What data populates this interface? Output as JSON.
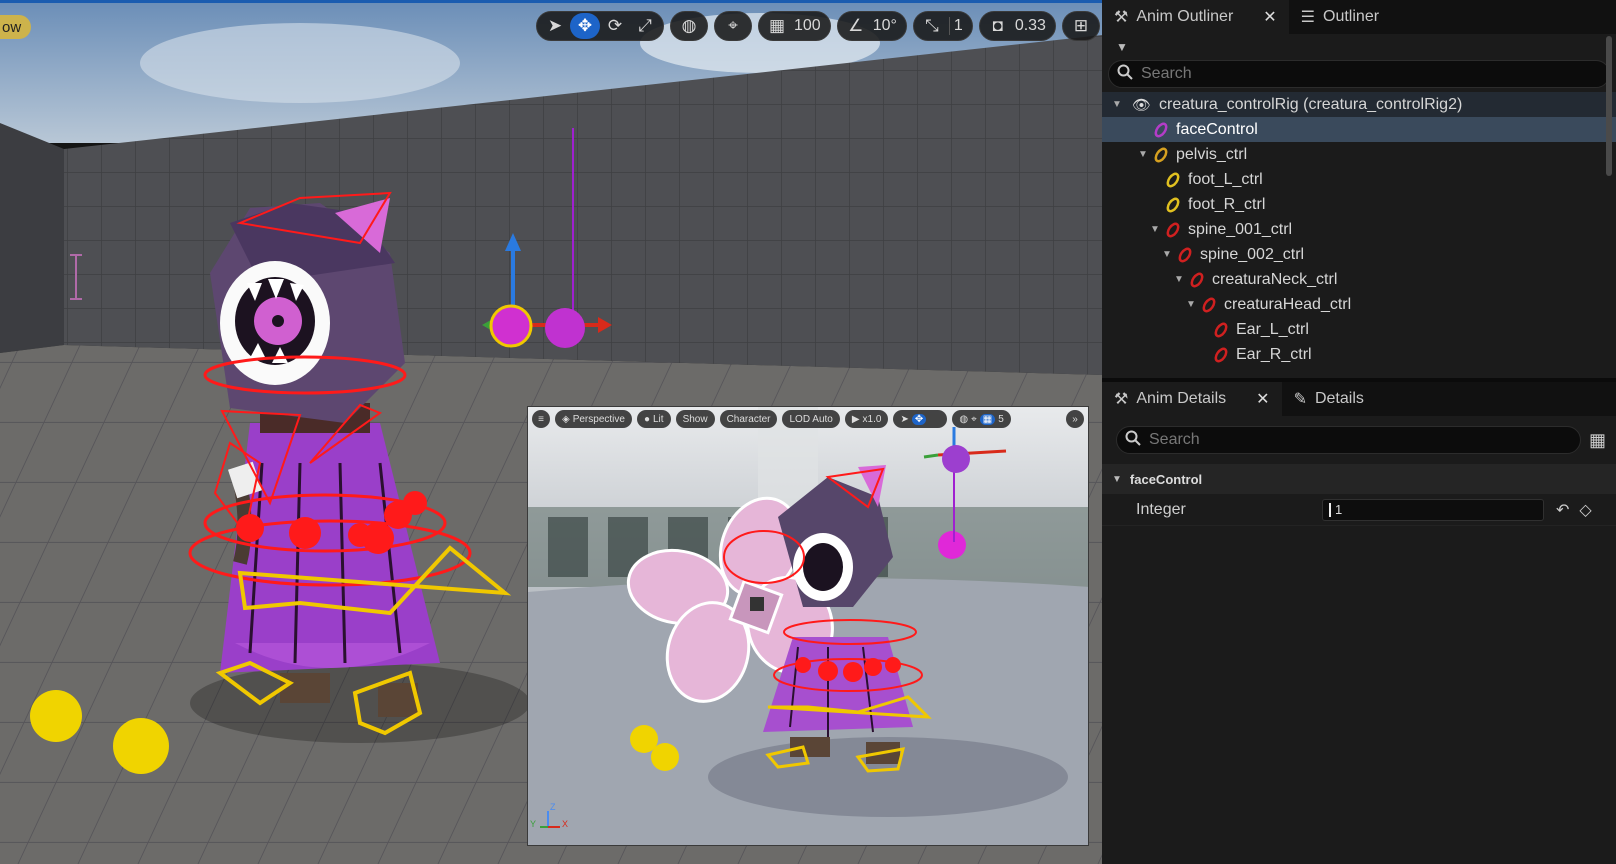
{
  "viewport": {
    "corner_label": "ow",
    "toolbar": {
      "grid_snap": "100",
      "angle_snap": "10°",
      "scale_snap": "1",
      "camera_speed": "0.33"
    }
  },
  "pip": {
    "menu_icon": "hamburger-icon",
    "perspective": "Perspective",
    "lit": "Lit",
    "show": "Show",
    "character": "Character",
    "lod": "LOD Auto",
    "play_rate": "x1.0",
    "grid_value": "5",
    "axis_z": "Z",
    "axis_y": "Y",
    "axis_x": "X"
  },
  "outliner": {
    "tab_anim": "Anim Outliner",
    "tab_outliner": "Outliner",
    "search_placeholder": "Search",
    "root": "creatura_controlRig  (creatura_controlRig2)",
    "items": [
      {
        "label": "faceControl",
        "color": "#b43cc8"
      },
      {
        "label": "pelvis_ctrl",
        "color": "#d6a020"
      },
      {
        "label": "foot_L_ctrl",
        "color": "#e0c020"
      },
      {
        "label": "foot_R_ctrl",
        "color": "#e0c020"
      },
      {
        "label": "spine_001_ctrl",
        "color": "#d02020"
      },
      {
        "label": "spine_002_ctrl",
        "color": "#d02020"
      },
      {
        "label": "creaturaNeck_ctrl",
        "color": "#d02020"
      },
      {
        "label": "creaturaHead_ctrl",
        "color": "#d02020"
      },
      {
        "label": "Ear_L_ctrl",
        "color": "#d02020"
      },
      {
        "label": "Ear_R_ctrl",
        "color": "#d02020"
      }
    ]
  },
  "details": {
    "tab_anim": "Anim Details",
    "tab_details": "Details",
    "search_placeholder": "Search",
    "section": "faceControl",
    "property_name": "Integer",
    "property_value": "1"
  },
  "colors": {
    "accent": "#1d64c8",
    "selection": "#3a4a5c",
    "control_red": "#e02020",
    "control_yellow": "#f0c800",
    "control_magenta": "#d020d0"
  }
}
